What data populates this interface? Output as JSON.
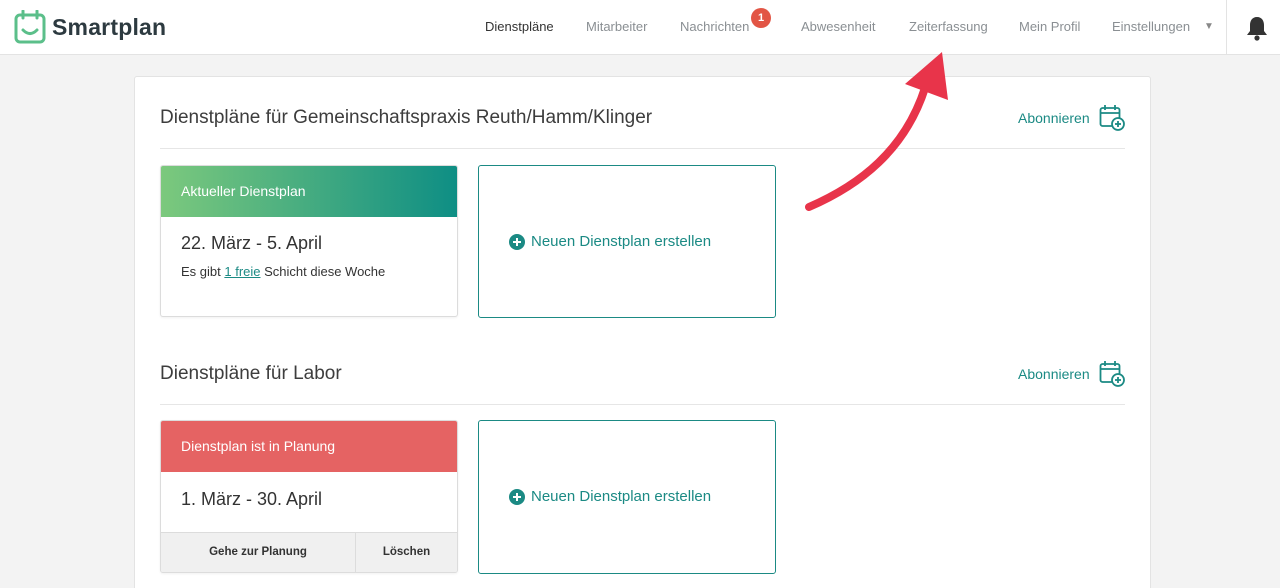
{
  "app": {
    "name": "Smartplan"
  },
  "nav": {
    "items": [
      {
        "label": "Dienstpläne",
        "active": true
      },
      {
        "label": "Mitarbeiter"
      },
      {
        "label": "Nachrichten",
        "badge": "1"
      },
      {
        "label": "Abwesenheit"
      },
      {
        "label": "Zeiterfassung"
      },
      {
        "label": "Mein Profil"
      },
      {
        "label": "Einstellungen"
      }
    ],
    "caret": "▼"
  },
  "sections": [
    {
      "title": "Dienstpläne für Gemeinschaftspraxis Reuth/Hamm/Klinger",
      "subscribe_label": "Abonnieren",
      "card": {
        "header": "Aktueller Dienstplan",
        "date_range": "22. März - 5. April",
        "note_prefix": "Es gibt ",
        "note_link": "1 freie",
        "note_suffix": " Schicht diese Woche"
      },
      "new_label": "Neuen Dienstplan erstellen"
    },
    {
      "title": "Dienstpläne für Labor",
      "subscribe_label": "Abonnieren",
      "card": {
        "header": "Dienstplan ist in Planung",
        "date_range": "1. März - 30. April",
        "btn_plan": "Gehe zur Planung",
        "btn_delete": "Löschen"
      },
      "new_label": "Neuen Dienstplan erstellen"
    }
  ],
  "colors": {
    "accent": "#1b8a84",
    "badge": "#e25545",
    "planning": "#e56363",
    "arrow": "#e8344a"
  }
}
